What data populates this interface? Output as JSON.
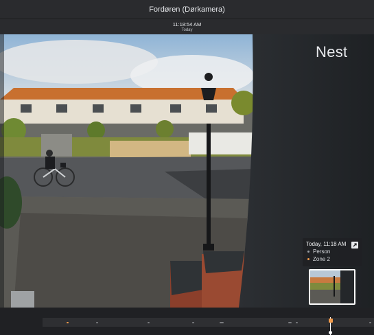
{
  "header": {
    "title": "Fordøren (Dørkamera)"
  },
  "timestamp": {
    "time": "11:18:54 AM",
    "day": "Today"
  },
  "overlay": {
    "brand": "Nest"
  },
  "event": {
    "time": "Today, 11:18 AM",
    "tags": [
      {
        "label": "Person",
        "color": "#9aa0a6"
      },
      {
        "label": "Zone 2",
        "color": "#f29b4b"
      }
    ]
  },
  "colors": {
    "accent": "#f29b4b",
    "background": "#202124",
    "bar": "#2a2b2e"
  },
  "icons": {
    "share": "share-icon"
  }
}
